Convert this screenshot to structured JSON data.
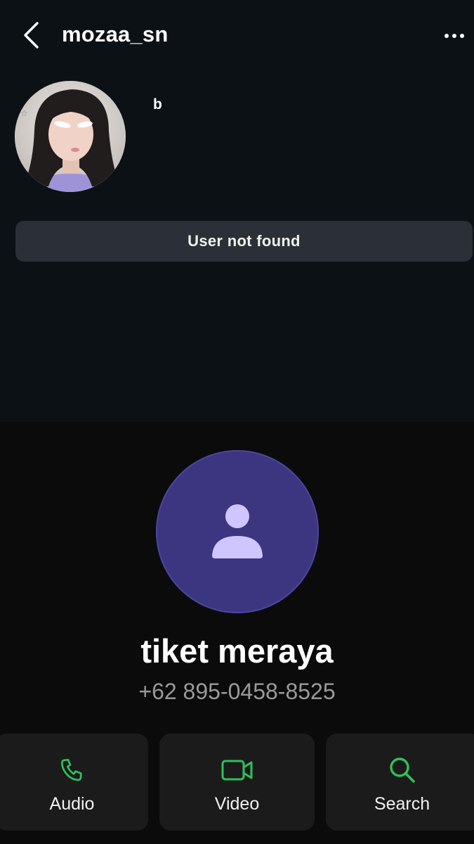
{
  "header": {
    "username": "mozaa_sn"
  },
  "profile": {
    "bio": "b",
    "status_button_label": "User not found"
  },
  "contact": {
    "name": "tiket meraya",
    "phone": "+62 895-0458-8525",
    "avatar_color": "#3c3580",
    "avatar_icon_color": "#cfc6ff"
  },
  "actions": [
    {
      "label": "Audio",
      "icon": "phone-icon"
    },
    {
      "label": "Video",
      "icon": "video-camera-icon"
    },
    {
      "label": "Search",
      "icon": "search-icon"
    }
  ],
  "colors": {
    "accent_green": "#2fc15a",
    "top_background": "#0c1116",
    "bottom_background": "#0b0b0b",
    "button_background": "#2b2f37",
    "action_background": "#1b1b1b"
  }
}
